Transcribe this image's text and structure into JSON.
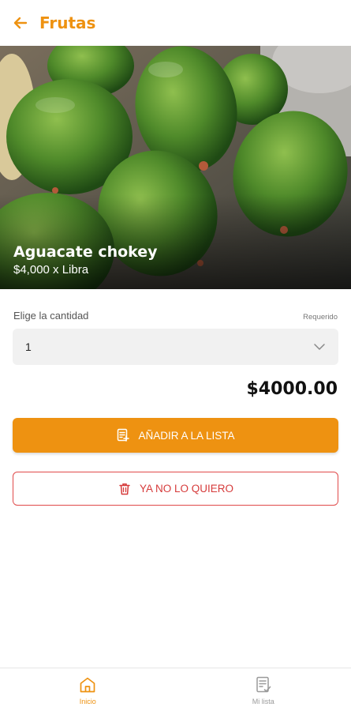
{
  "header": {
    "title": "Frutas",
    "back_icon": "arrow-left-icon"
  },
  "product": {
    "name": "Aguacate chokey",
    "price_unit": "$4,000 x Libra"
  },
  "quantity": {
    "label": "Elige la cantidad",
    "required": "Requerido",
    "selected": "1"
  },
  "total": "$4000.00",
  "actions": {
    "add_label": "AÑADIR A LA LISTA",
    "remove_label": "YA NO LO QUIERO"
  },
  "nav": {
    "items": [
      {
        "label": "Inicio",
        "icon": "home-icon"
      },
      {
        "label": "Mi lista",
        "icon": "list-icon"
      }
    ]
  },
  "colors": {
    "accent": "#ee9211",
    "danger": "#d63b3b"
  }
}
